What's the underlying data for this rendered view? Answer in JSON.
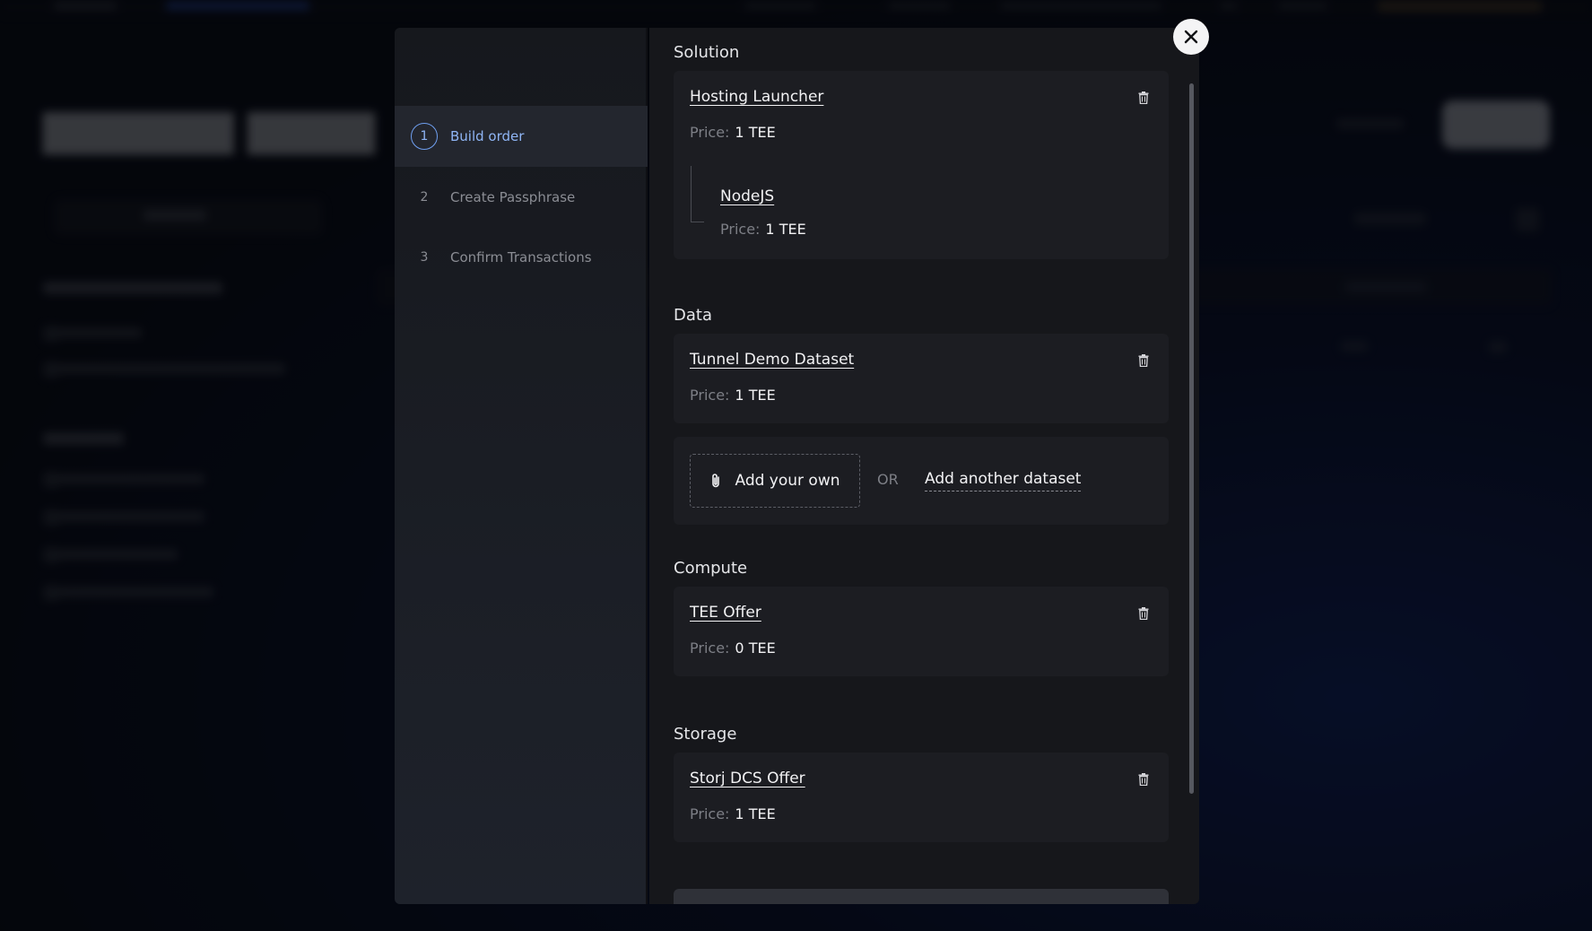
{
  "steps": [
    {
      "number": "1",
      "label": "Build order"
    },
    {
      "number": "2",
      "label": "Create Passphrase"
    },
    {
      "number": "3",
      "label": "Confirm Transactions"
    }
  ],
  "price_label": "Price:",
  "sections": {
    "solution": {
      "title": "Solution",
      "item": {
        "name": "Hosting Launcher",
        "price": "1 TEE"
      },
      "child": {
        "name": "NodeJS",
        "price": "1 TEE"
      }
    },
    "data": {
      "title": "Data",
      "item": {
        "name": "Tunnel Demo Dataset",
        "price": "1 TEE"
      },
      "add_own": "Add your own",
      "or": "OR",
      "add_another": "Add another dataset"
    },
    "compute": {
      "title": "Compute",
      "item": {
        "name": "TEE Offer",
        "price": "0 TEE"
      }
    },
    "storage": {
      "title": "Storage",
      "item": {
        "name": "Storj DCS Offer",
        "price": "1 TEE"
      }
    }
  },
  "icons": {
    "close": "close-icon",
    "trash": "trash-icon",
    "attach": "paperclip-icon"
  },
  "colors": {
    "accent": "#8fb5f5",
    "modal_bg": "#16171b",
    "card_bg": "#1c1d22"
  }
}
